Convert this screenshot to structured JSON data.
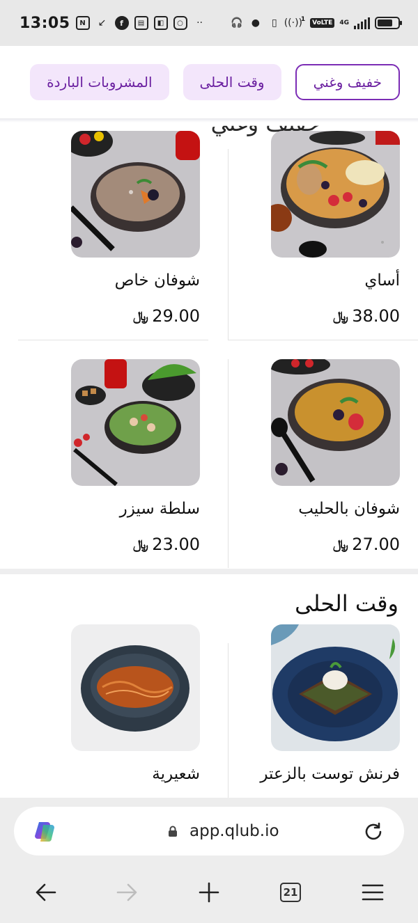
{
  "status_bar": {
    "time": "13:05",
    "left_icons": [
      "nfc-icon",
      "missed-call-icon",
      "facebook-icon",
      "app-icon",
      "app-icon",
      "instagram-icon",
      "more-dots-icon"
    ],
    "right_icons": [
      "headset-icon",
      "location-icon",
      "vibrate-icon",
      "hotspot-icon"
    ],
    "hotspot_sup": "1",
    "volte": "VoLTE",
    "network": "4G",
    "battery_level": 0.75
  },
  "tabs": [
    {
      "label": "خفيف وغني",
      "active": true
    },
    {
      "label": "وقت الحلى",
      "active": false
    },
    {
      "label": "المشروبات الباردة",
      "active": false
    }
  ],
  "currency_symbol": "﷼",
  "section_1": {
    "items": [
      {
        "name": "أساي",
        "price": "38.00"
      },
      {
        "name": "شوفان خاص",
        "price": "29.00"
      },
      {
        "name": "شوفان بالحليب",
        "price": "27.00"
      },
      {
        "name": "سلطة سيزر",
        "price": "23.00"
      }
    ]
  },
  "section_2": {
    "title": "وقت الحلى",
    "items": [
      {
        "name": "فرنش توست بالزعتر"
      },
      {
        "name": "شعيرية"
      }
    ]
  },
  "browser": {
    "url": "app.qlub.io",
    "tab_count": "21",
    "icons": [
      "copilot-icon",
      "lock-icon",
      "reload-icon",
      "back-arrow-icon",
      "forward-arrow-icon",
      "new-tab-plus-icon",
      "tabs-icon",
      "menu-icon"
    ]
  }
}
